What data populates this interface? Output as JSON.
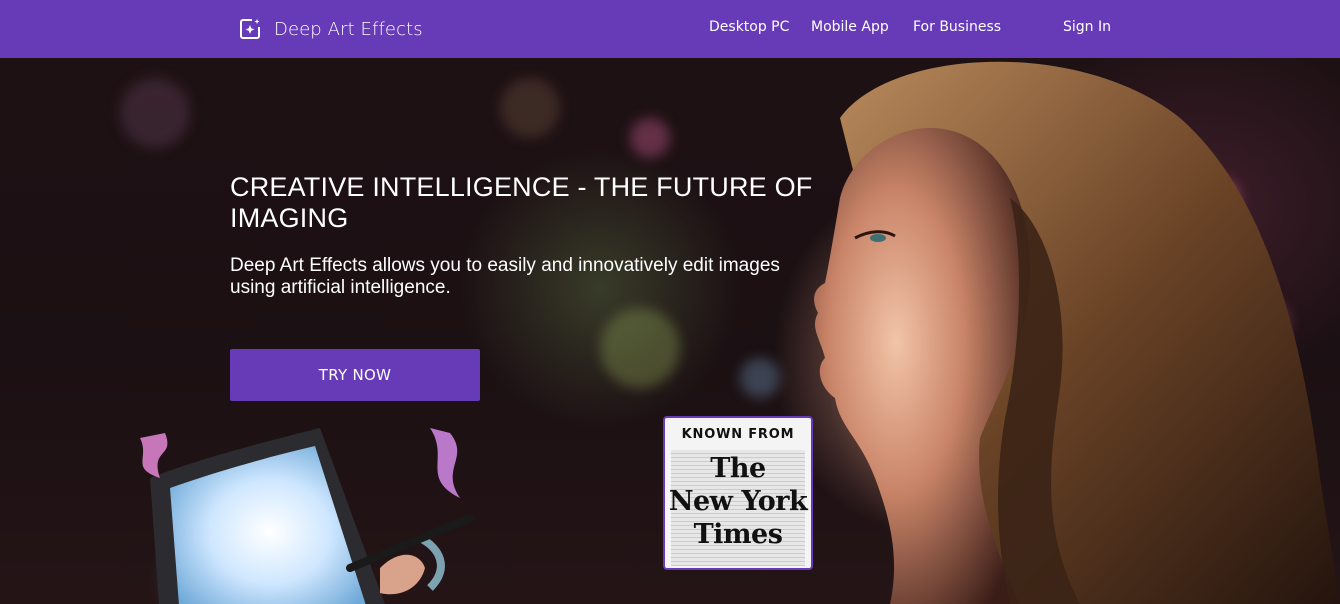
{
  "brand": {
    "name": "Deep Art Effects",
    "icon": "sparkle-frame-icon"
  },
  "nav": {
    "items": [
      {
        "label": "Desktop PC"
      },
      {
        "label": "Mobile App"
      },
      {
        "label": "For Business"
      }
    ],
    "sign_in": "Sign In"
  },
  "hero": {
    "title": "CREATIVE INTELLIGENCE - THE FUTURE OF IMAGING",
    "subtitle": "Deep Art Effects allows you to easily and innovatively edit images using artificial intelligence.",
    "cta_label": "TRY NOW"
  },
  "press": {
    "known_from": "KNOWN FROM",
    "logo_lines": [
      "The",
      "New York",
      "Times"
    ]
  },
  "colors": {
    "brand_purple": "#673ab7",
    "nav_text": "#ffffff",
    "hero_text": "#ffffff"
  }
}
